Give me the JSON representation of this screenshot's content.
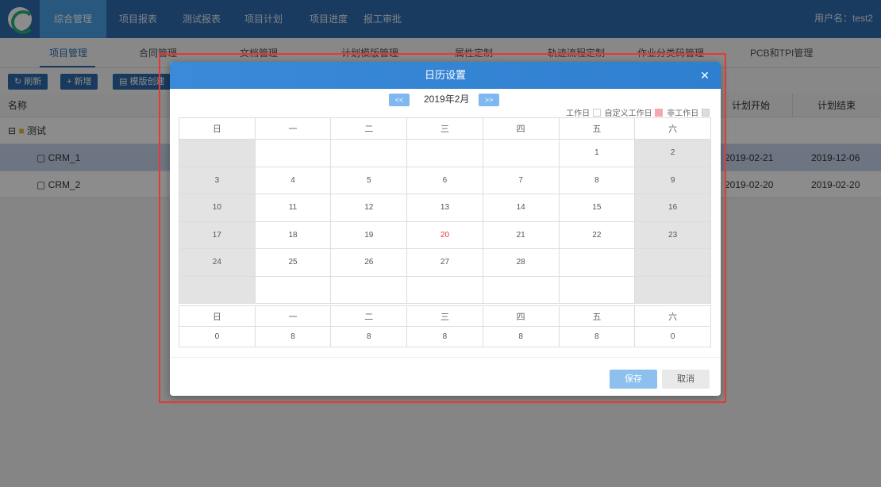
{
  "nav": {
    "items": [
      "综合管理",
      "项目报表",
      "测试报表",
      "项目计划",
      "项目进度",
      "报工审批"
    ],
    "user_label": "用户名：test2"
  },
  "tabs": [
    "项目管理",
    "合同管理",
    "文档管理",
    "计划模版管理",
    "属性定制",
    "轨迹流程定制",
    "作业分类码管理",
    "PCB和TPI管理"
  ],
  "toolbar": {
    "refresh": "刷新",
    "add": "新增",
    "template": "模版创建"
  },
  "grid": {
    "headers": {
      "name": "名称",
      "plan_start": "计划开始",
      "plan_end": "计划结束"
    },
    "group": "测试",
    "rows": [
      {
        "name": "CRM_1",
        "plan_start": "2019-02-21",
        "plan_end": "2019-12-06"
      },
      {
        "name": "CRM_2",
        "plan_start": "2019-02-20",
        "plan_end": "2019-02-20"
      }
    ]
  },
  "dialog": {
    "title": "日历设置",
    "prev": "<<",
    "next": ">>",
    "month": "2019年2月",
    "legend": {
      "workday": "工作日",
      "custom": "自定义工作日",
      "nonwork": "非工作日"
    },
    "legend_colors": {
      "workday": "#ffffff",
      "custom": "#f4a7b0",
      "nonwork": "#dcdcdc"
    },
    "weekdays": [
      "日",
      "一",
      "二",
      "三",
      "四",
      "五",
      "六"
    ],
    "weeks": [
      [
        "",
        "",
        "",
        "",
        "",
        "1",
        "2"
      ],
      [
        "3",
        "4",
        "5",
        "6",
        "7",
        "8",
        "9"
      ],
      [
        "10",
        "11",
        "12",
        "13",
        "14",
        "15",
        "16"
      ],
      [
        "17",
        "18",
        "19",
        "20",
        "21",
        "22",
        "23"
      ],
      [
        "24",
        "25",
        "26",
        "27",
        "28",
        "",
        ""
      ],
      [
        "",
        "",
        "",
        "",
        "",
        "",
        ""
      ]
    ],
    "today": "20",
    "hours": [
      "0",
      "8",
      "8",
      "8",
      "8",
      "8",
      "0"
    ],
    "save": "保存",
    "cancel": "取消"
  }
}
